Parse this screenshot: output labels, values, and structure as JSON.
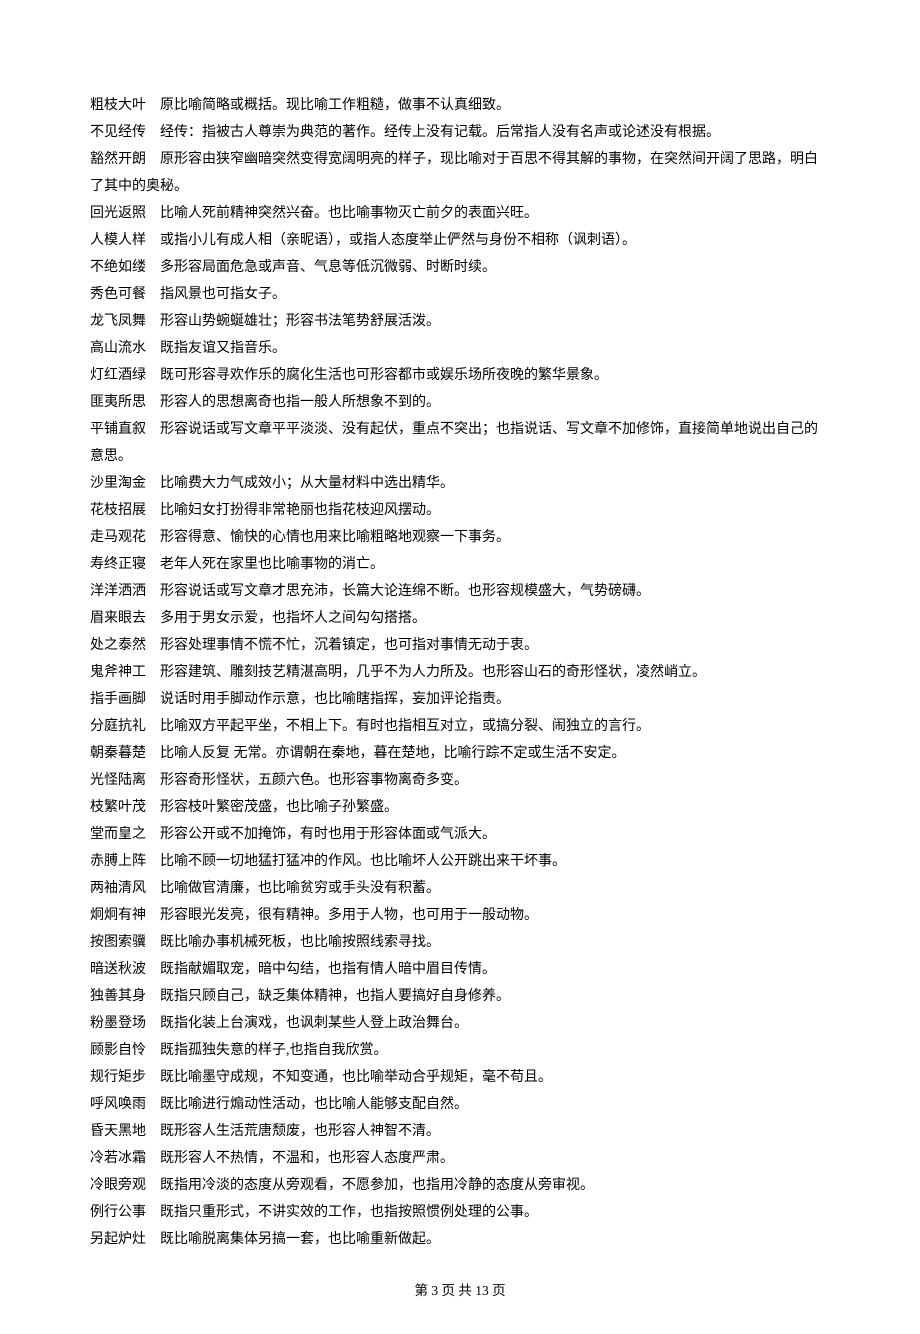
{
  "entries": [
    {
      "term": "粗枝大叶",
      "def": "原比喻简略或概括。现比喻工作粗糙，做事不认真细致。"
    },
    {
      "term": "不见经传",
      "def": "经传：指被古人尊崇为典范的著作。经传上没有记载。后常指人没有名声或论述没有根据。"
    },
    {
      "term": "豁然开朗",
      "def": "原形容由狭窄幽暗突然变得宽阔明亮的样子，现比喻对于百思不得其解的事物，在突然间开阔了思路，明白了其中的奥秘。"
    },
    {
      "term": "回光返照",
      "def": "比喻人死前精神突然兴奋。也比喻事物灭亡前夕的表面兴旺。"
    },
    {
      "term": "人模人样",
      "def": "或指小儿有成人相（亲昵语），或指人态度举止俨然与身份不相称（讽刺语）。"
    },
    {
      "term": "不绝如缕",
      "def": "多形容局面危急或声音、气息等低沉微弱、时断时续。"
    },
    {
      "term": "秀色可餐",
      "def": "指风景也可指女子。"
    },
    {
      "term": "龙飞凤舞",
      "def": "形容山势蜿蜒雄壮；形容书法笔势舒展活泼。"
    },
    {
      "term": "高山流水",
      "def": "既指友谊又指音乐。"
    },
    {
      "term": "灯红酒绿",
      "def": "既可形容寻欢作乐的腐化生活也可形容都市或娱乐场所夜晚的繁华景象。"
    },
    {
      "term": "匪夷所思",
      "def": "形容人的思想离奇也指一般人所想象不到的。"
    },
    {
      "term": "平铺直叙",
      "def": "形容说话或写文章平平淡淡、没有起伏，重点不突出；也指说话、写文章不加修饰，直接简单地说出自己的意思。"
    },
    {
      "term": "沙里淘金",
      "def": "比喻费大力气成效小；从大量材料中选出精华。"
    },
    {
      "term": "花枝招展",
      "def": "比喻妇女打扮得非常艳丽也指花枝迎风摆动。"
    },
    {
      "term": "走马观花",
      "def": "形容得意、愉快的心情也用来比喻粗略地观察一下事务。"
    },
    {
      "term": "寿终正寝",
      "def": "老年人死在家里也比喻事物的消亡。"
    },
    {
      "term": "洋洋洒洒",
      "def": "形容说话或写文章才思充沛，长篇大论连绵不断。也形容规模盛大，气势磅礴。"
    },
    {
      "term": "眉来眼去",
      "def": "多用于男女示爱，也指坏人之间勾勾搭搭。"
    },
    {
      "term": "处之泰然",
      "def": "形容处理事情不慌不忙，沉着镇定，也可指对事情无动于衷。"
    },
    {
      "term": "鬼斧神工",
      "def": "形容建筑、雕刻技艺精湛高明，几乎不为人力所及。也形容山石的奇形怪状，凌然峭立。"
    },
    {
      "term": "指手画脚",
      "def": "说话时用手脚动作示意，也比喻瞎指挥，妄加评论指责。"
    },
    {
      "term": "分庭抗礼",
      "def": "比喻双方平起平坐，不相上下。有时也指相互对立，或搞分裂、闹独立的言行。"
    },
    {
      "term": "朝秦暮楚",
      "def": "比喻人反复 无常。亦谓朝在秦地，暮在楚地，比喻行踪不定或生活不安定。"
    },
    {
      "term": "光怪陆离",
      "def": "形容奇形怪状，五颜六色。也形容事物离奇多变。"
    },
    {
      "term": "枝繁叶茂",
      "def": "形容枝叶繁密茂盛，也比喻子孙繁盛。"
    },
    {
      "term": "堂而皇之",
      "def": "形容公开或不加掩饰，有时也用于形容体面或气派大。"
    },
    {
      "term": "赤膊上阵",
      "def": "比喻不顾一切地猛打猛冲的作风。也比喻坏人公开跳出来干坏事。"
    },
    {
      "term": "两袖清风",
      "def": "比喻做官清廉，也比喻贫穷或手头没有积蓄。"
    },
    {
      "term": "炯炯有神",
      "def": "形容眼光发亮，很有精神。多用于人物，也可用于一般动物。"
    },
    {
      "term": "按图索骥",
      "def": "既比喻办事机械死板，也比喻按照线索寻找。"
    },
    {
      "term": "暗送秋波",
      "def": "既指献媚取宠，暗中勾结，也指有情人暗中眉目传情。"
    },
    {
      "term": "独善其身",
      "def": "既指只顾自己，缺乏集体精神，也指人要搞好自身修养。"
    },
    {
      "term": "粉墨登场",
      "def": "既指化装上台演戏，也讽刺某些人登上政治舞台。"
    },
    {
      "term": "顾影自怜",
      "def": "既指孤独失意的样子,也指自我欣赏。"
    },
    {
      "term": "规行矩步",
      "def": "既比喻墨守成规，不知变通，也比喻举动合乎规矩，毫不苟且。"
    },
    {
      "term": "呼风唤雨",
      "def": "既比喻进行煽动性活动，也比喻人能够支配自然。"
    },
    {
      "term": "昏天黑地",
      "def": "既形容人生活荒唐颓废，也形容人神智不清。"
    },
    {
      "term": "冷若冰霜",
      "def": "既形容人不热情，不温和，也形容人态度严肃。"
    },
    {
      "term": "冷眼旁观",
      "def": "既指用冷淡的态度从旁观看，不愿参加，也指用冷静的态度从旁审视。"
    },
    {
      "term": "例行公事",
      "def": "既指只重形式，不讲实效的工作，也指按照惯例处理的公事。"
    },
    {
      "term": "另起炉灶",
      "def": "既比喻脱离集体另搞一套，也比喻重新做起。"
    }
  ],
  "footer": {
    "prefix": "第 ",
    "page_num": "3",
    "middle": " 页 共 ",
    "total": "13",
    "suffix": " 页"
  }
}
